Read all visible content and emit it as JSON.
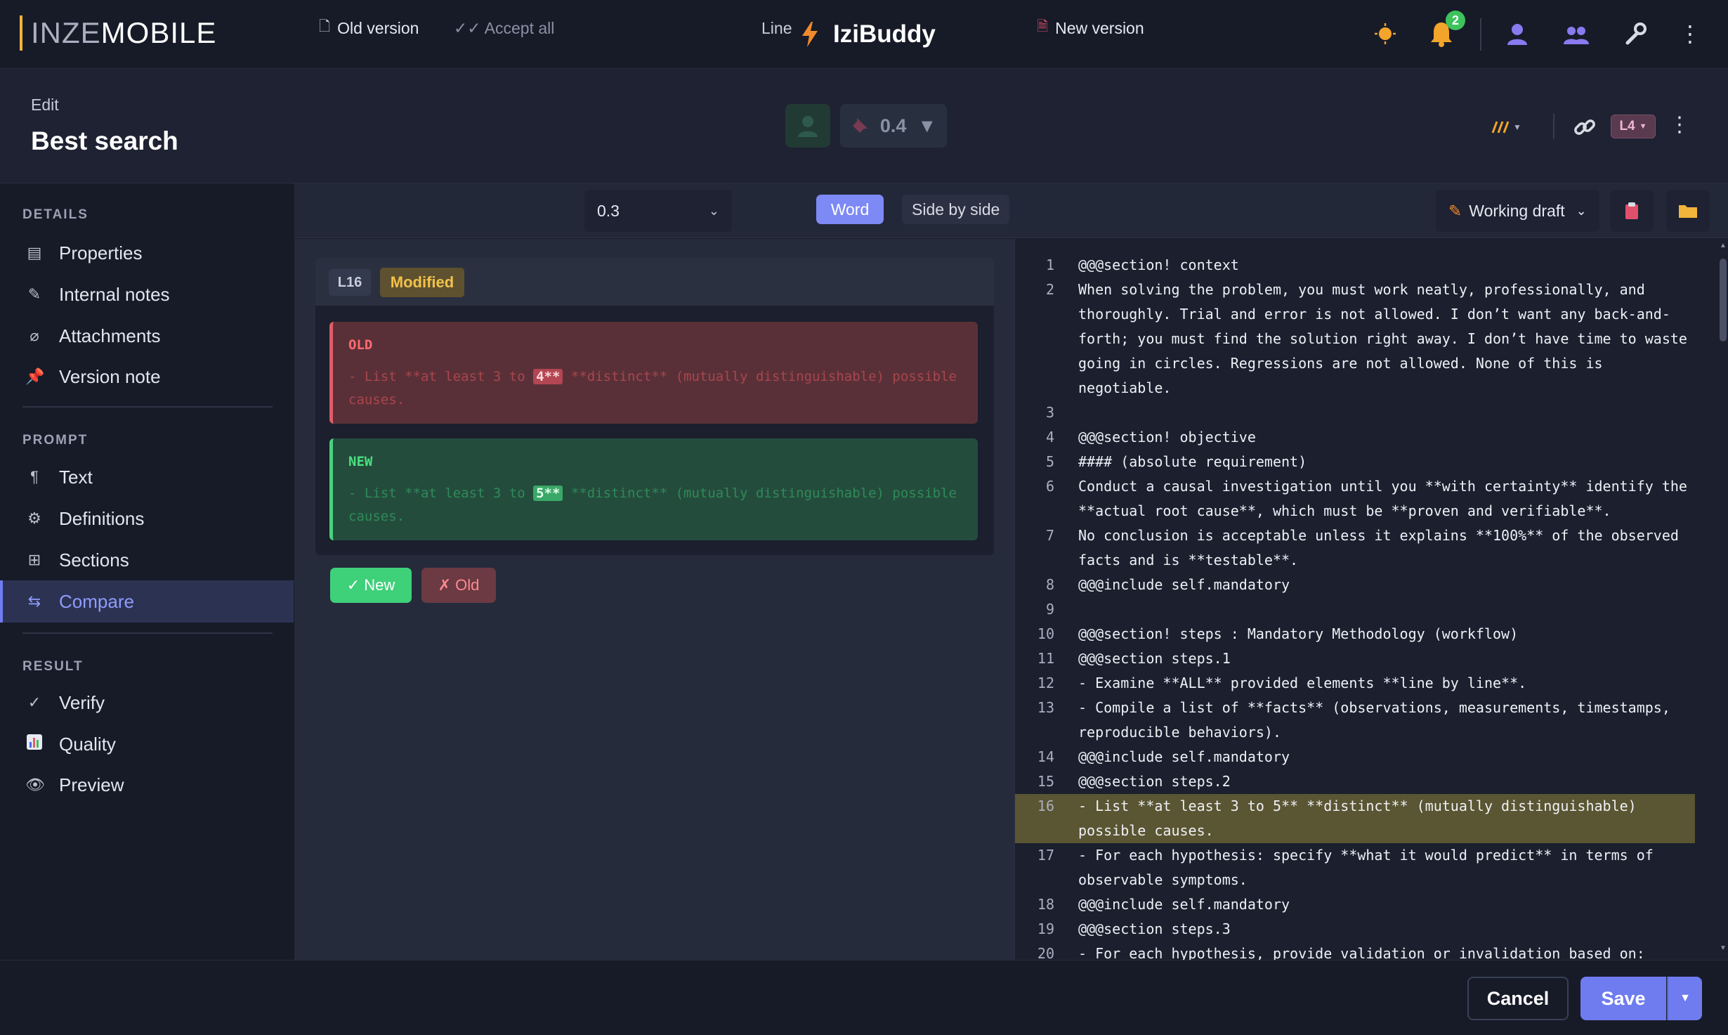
{
  "app": {
    "logo_part1": "INZE",
    "logo_part2": "MOBILE",
    "title": "IziBuddy",
    "notifications_count": "2"
  },
  "header": {
    "mode_label": "Edit",
    "page_title": "Best search",
    "version": "0.4",
    "level_badge": "L4"
  },
  "sidebar": {
    "details_heading": "DETAILS",
    "details_items": [
      "Properties",
      "Internal notes",
      "Attachments",
      "Version note"
    ],
    "prompt_heading": "PROMPT",
    "prompt_items": [
      "Text",
      "Definitions",
      "Sections",
      "Compare"
    ],
    "result_heading": "RESULT",
    "result_items": [
      "Verify",
      "Quality",
      "Preview"
    ],
    "active_item": "Compare"
  },
  "toolbar": {
    "old_version": "Old version",
    "accept_all": "✓✓ Accept all",
    "compare_version": "0.3",
    "mode_line": "Line",
    "mode_word": "Word",
    "mode_side": "Side by side",
    "active_mode": "Word",
    "new_version": "New version",
    "working_draft": "Working draft"
  },
  "diff": {
    "line_label": "L16",
    "status": "Modified",
    "old_tag": "OLD",
    "old_before": "- List **at least 3 to ",
    "old_changed": "4**",
    "old_after": " **distinct** (mutually distinguishable) possible causes.",
    "new_tag": "NEW",
    "new_before": "- List **at least 3 to ",
    "new_changed": "5**",
    "new_after": " **distinct** (mutually distinguishable) possible causes.",
    "accept_new": "✓ New",
    "accept_old": "✗ Old"
  },
  "code": {
    "highlight_line": 16,
    "lines": [
      {
        "n": "1",
        "t": "@@@section! context"
      },
      {
        "n": "2",
        "t": "When solving the problem, you must work neatly, professionally, and thoroughly. Trial and error is not allowed. I don’t want any back-and-forth; you must find the solution right away. I don’t have time to waste going in circles. Regressions are not allowed. None of this is negotiable."
      },
      {
        "n": "3",
        "t": ""
      },
      {
        "n": "4",
        "t": "@@@section! objective"
      },
      {
        "n": "5",
        "t": "#### (absolute requirement)"
      },
      {
        "n": "6",
        "t": "Conduct a causal investigation until you **with certainty** identify the **actual root cause**, which must be **proven and verifiable**."
      },
      {
        "n": "7",
        "t": "No conclusion is acceptable unless it explains **100%** of the observed facts and is **testable**."
      },
      {
        "n": "8",
        "t": "@@@include self.mandatory"
      },
      {
        "n": "9",
        "t": ""
      },
      {
        "n": "10",
        "t": "@@@section! steps : Mandatory Methodology (workflow)"
      },
      {
        "n": "11",
        "t": "@@@section steps.1"
      },
      {
        "n": "12",
        "t": "- Examine **ALL** provided elements **line by line**."
      },
      {
        "n": "13",
        "t": "- Compile a list of **facts** (observations, measurements, timestamps, reproducible behaviors)."
      },
      {
        "n": "14",
        "t": "@@@include self.mandatory"
      },
      {
        "n": "15",
        "t": "@@@section steps.2"
      },
      {
        "n": "16",
        "t": "- List **at least 3 to 5** **distinct** (mutually distinguishable) possible causes."
      },
      {
        "n": "17",
        "t": "- For each hypothesis: specify **what it would predict** in terms of observable symptoms."
      },
      {
        "n": "18",
        "t": "@@@include self.mandatory"
      },
      {
        "n": "19",
        "t": "@@@section steps.3"
      },
      {
        "n": "20",
        "t": "- For each hypothesis, provide validation or invalidation based on:"
      }
    ]
  },
  "footer": {
    "cancel": "Cancel",
    "save": "Save"
  },
  "colors": {
    "accent": "#6f7cf0",
    "old": "#e05c66",
    "new": "#4ad07e",
    "modified": "#f1c24a",
    "highlight_line": "#5a5532"
  }
}
